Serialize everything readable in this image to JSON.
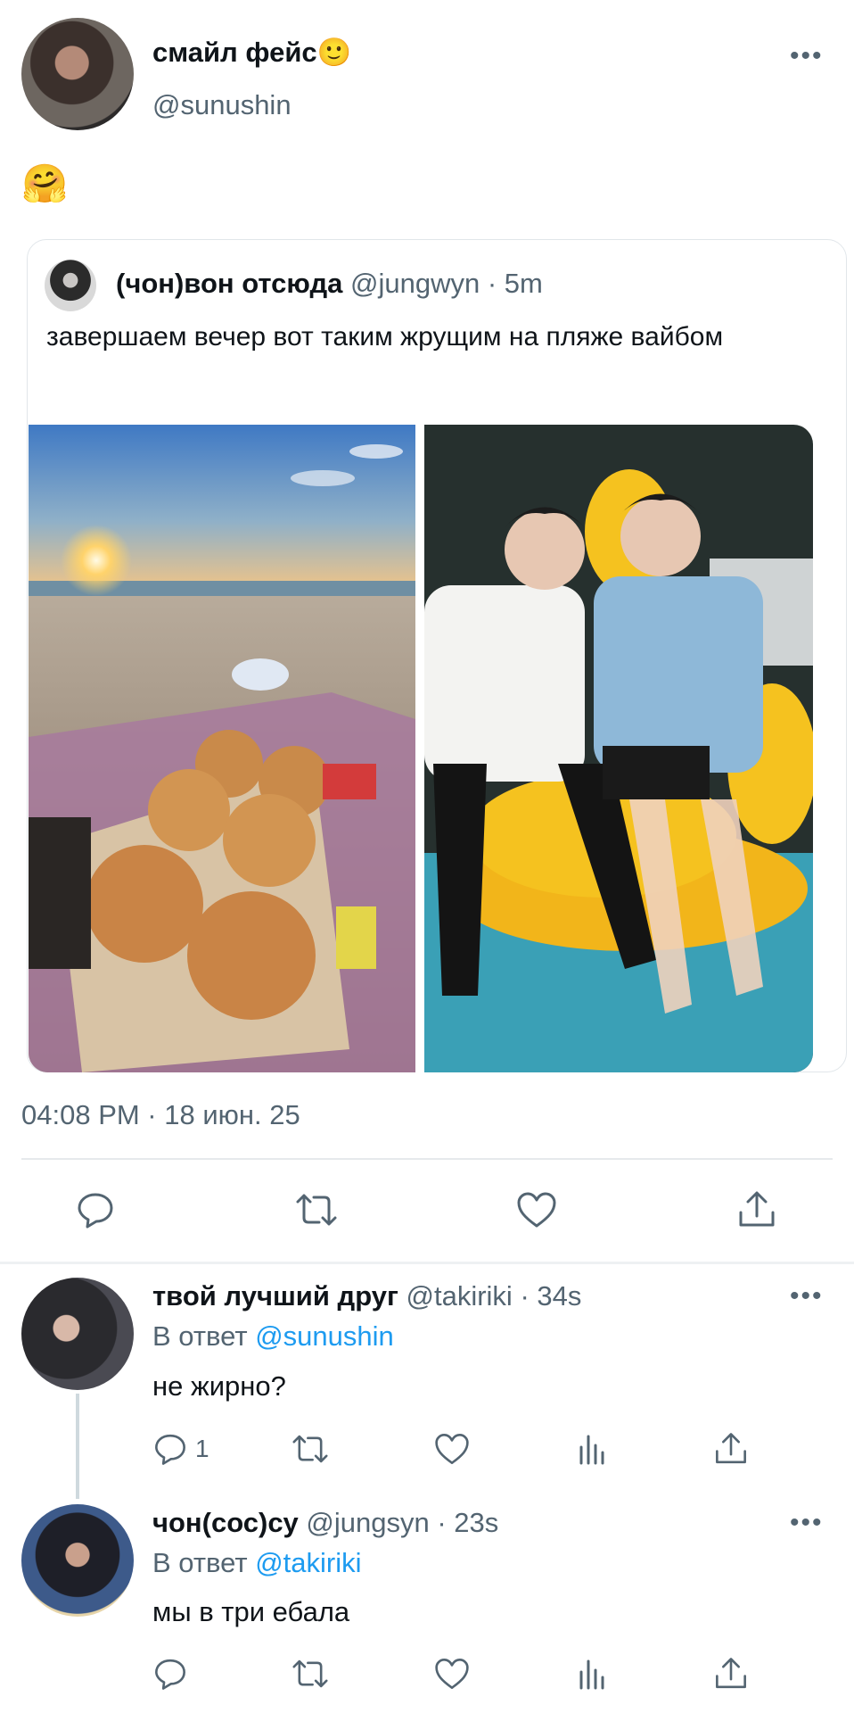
{
  "main_tweet": {
    "display_name": "смайл фейс🙂",
    "handle": "@sunushin",
    "text": "🤗",
    "timestamp": "04:08 PM · 18 июн. 25"
  },
  "quoted_tweet": {
    "display_name": "(чон)вон отсюда",
    "handle": "@jungwyn",
    "time": "· 5m",
    "text": "завершаем вечер вот таким жрущим на пляже вайбом",
    "images": [
      "beach-pizza-sunset-photo",
      "two-people-yellow-float-pool-photo"
    ]
  },
  "actions": {
    "icons": [
      "reply-icon",
      "retweet-icon",
      "like-icon",
      "share-icon"
    ]
  },
  "replies": [
    {
      "display_name": "твой лучший друг",
      "handle": "@takiriki",
      "time": "· 34s",
      "reply_prefix": "В ответ",
      "reply_to": "@sunushin",
      "text": "не жирно?",
      "reply_count": "1"
    },
    {
      "display_name": "чон(сос)су",
      "handle": "@jungsyn",
      "time": "· 23s",
      "reply_prefix": "В ответ",
      "reply_to": "@takiriki",
      "text": "мы в три ебала",
      "reply_count": ""
    }
  ],
  "colors": {
    "text": "#0f1419",
    "muted": "#536471",
    "link": "#1d9bf0",
    "divider": "#e6e9ec"
  }
}
